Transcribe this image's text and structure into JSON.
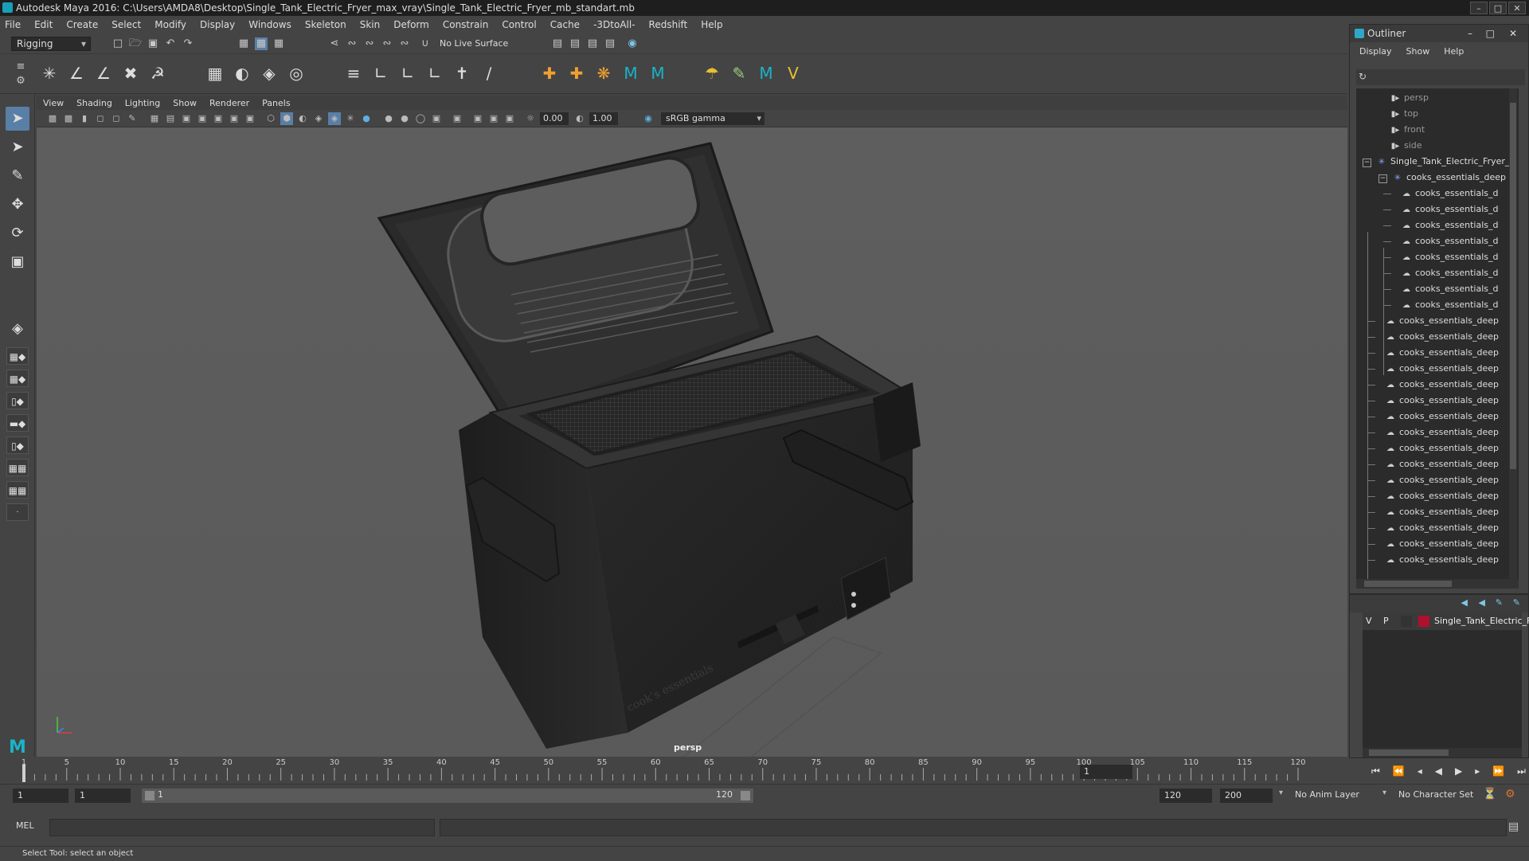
{
  "window": {
    "title": "Autodesk Maya 2016: C:\\Users\\AMDA8\\Desktop\\Single_Tank_Electric_Fryer_max_vray\\Single_Tank_Electric_Fryer_mb_standart.mb",
    "minimize": "–",
    "maximize": "□",
    "close": "✕"
  },
  "menubar": [
    "File",
    "Edit",
    "Create",
    "Select",
    "Modify",
    "Display",
    "Windows",
    "Skeleton",
    "Skin",
    "Deform",
    "Constrain",
    "Control",
    "Cache",
    "-3DtoAll-",
    "Redshift",
    "Help"
  ],
  "statusline": {
    "mode": "Rigging",
    "live_surface": "No Live Surface"
  },
  "viewport": {
    "menu": [
      "View",
      "Shading",
      "Lighting",
      "Show",
      "Renderer",
      "Panels"
    ],
    "exposure": "0.00",
    "gamma": "1.00",
    "color_space": "sRGB gamma",
    "camera": "persp",
    "brand_text": "cook's essentials"
  },
  "timeline": {
    "ticks": [
      "5",
      "10",
      "15",
      "20",
      "25",
      "30",
      "35",
      "40",
      "45",
      "50",
      "55",
      "60",
      "65",
      "70",
      "75",
      "80",
      "85",
      "90",
      "95",
      "100",
      "105",
      "110",
      "115",
      "120"
    ],
    "start_tick": "1",
    "current_frame": "1"
  },
  "range": {
    "start": "1",
    "playback_start": "1",
    "slider_start": "1",
    "slider_end": "120",
    "playback_end": "120",
    "end": "200",
    "anim_layer": "No Anim Layer",
    "character_set": "No Character Set"
  },
  "playback_icons": [
    "⏮",
    "⏪",
    "◂",
    "◀",
    "▶",
    "▸",
    "⏩",
    "⏭"
  ],
  "cmdline": {
    "label": "MEL"
  },
  "helpline": "Select Tool: select an object",
  "outliner": {
    "title": "Outliner",
    "menu": [
      "Display",
      "Show",
      "Help"
    ],
    "cameras": [
      "persp",
      "top",
      "front",
      "side"
    ],
    "root": "Single_Tank_Electric_Fryer_",
    "group": "cooks_essentials_deep",
    "children": [
      "cooks_essentials_d",
      "cooks_essentials_d",
      "cooks_essentials_d",
      "cooks_essentials_d",
      "cooks_essentials_d",
      "cooks_essentials_d",
      "cooks_essentials_d",
      "cooks_essentials_d"
    ],
    "siblings": [
      "cooks_essentials_deep",
      "cooks_essentials_deep",
      "cooks_essentials_deep",
      "cooks_essentials_deep",
      "cooks_essentials_deep",
      "cooks_essentials_deep",
      "cooks_essentials_deep",
      "cooks_essentials_deep",
      "cooks_essentials_deep",
      "cooks_essentials_deep",
      "cooks_essentials_deep",
      "cooks_essentials_deep",
      "cooks_essentials_deep",
      "cooks_essentials_deep",
      "cooks_essentials_deep",
      "cooks_essentials_deep"
    ]
  },
  "layers": {
    "v": "V",
    "p": "P",
    "name": "Single_Tank_Electric_Fr",
    "color": "#b01030"
  },
  "colors": {
    "accent": "#5a7fa6",
    "maya_cyan": "#18a0b8"
  }
}
